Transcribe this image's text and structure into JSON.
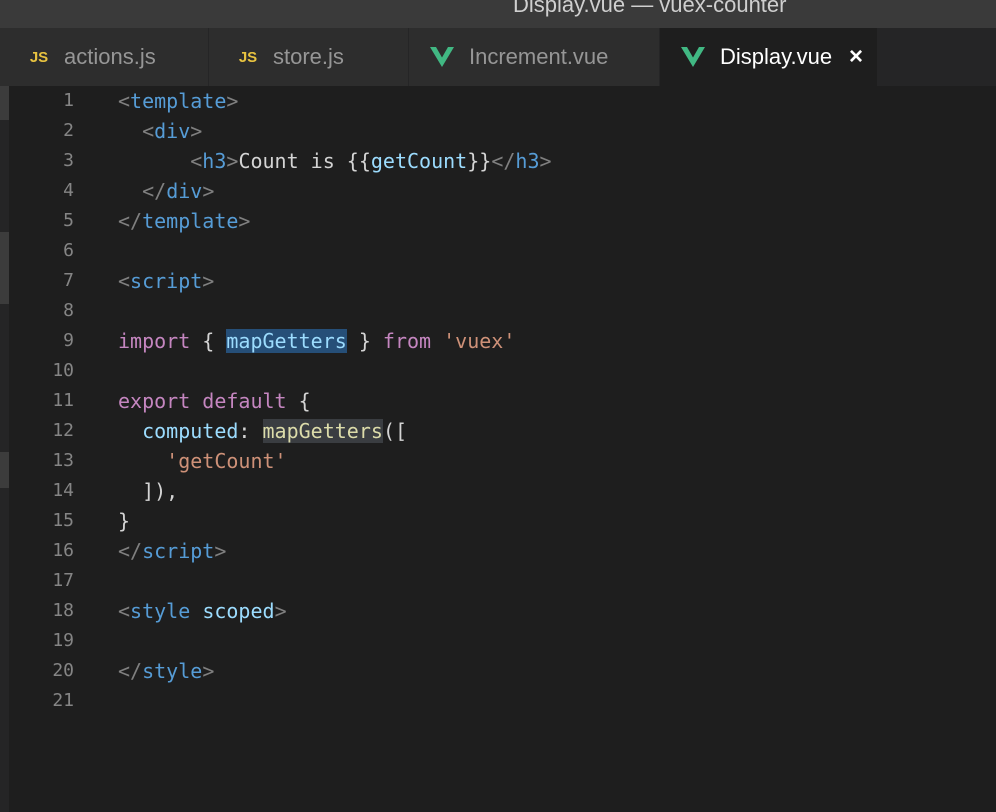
{
  "window": {
    "title": "Display.vue — vuex-counter"
  },
  "tabs": [
    {
      "label": "actions.js",
      "icon": "js-icon",
      "icon_text": "JS",
      "active": false
    },
    {
      "label": "store.js",
      "icon": "js-icon",
      "icon_text": "JS",
      "active": false
    },
    {
      "label": "Increment.vue",
      "icon": "vue-icon",
      "active": false
    },
    {
      "label": "Display.vue",
      "icon": "vue-icon",
      "active": true,
      "close_symbol": "×"
    }
  ],
  "colors": {
    "background": "#1e1e1e",
    "tab_inactive": "#2d2d2d",
    "js_icon": "#e8c340",
    "vue_icon": "#41b883"
  },
  "editor": {
    "line_numbers": [
      "1",
      "2",
      "3",
      "4",
      "5",
      "6",
      "7",
      "8",
      "9",
      "10",
      "11",
      "12",
      "13",
      "14",
      "15",
      "16",
      "17",
      "18",
      "19",
      "20",
      "21"
    ],
    "lines": [
      [
        {
          "t": "<",
          "c": "tag-bracket"
        },
        {
          "t": "template",
          "c": "tag"
        },
        {
          "t": ">",
          "c": "tag-bracket"
        }
      ],
      [
        {
          "t": "  ",
          "c": "plain"
        },
        {
          "t": "<",
          "c": "tag-bracket"
        },
        {
          "t": "div",
          "c": "tag"
        },
        {
          "t": ">",
          "c": "tag-bracket"
        }
      ],
      [
        {
          "t": "      ",
          "c": "plain"
        },
        {
          "t": "<",
          "c": "tag-bracket"
        },
        {
          "t": "h3",
          "c": "tag"
        },
        {
          "t": ">",
          "c": "tag-bracket"
        },
        {
          "t": "Count is {{",
          "c": "plain"
        },
        {
          "t": "getCount",
          "c": "prop"
        },
        {
          "t": "}}",
          "c": "plain"
        },
        {
          "t": "</",
          "c": "tag-bracket"
        },
        {
          "t": "h3",
          "c": "tag"
        },
        {
          "t": ">",
          "c": "tag-bracket"
        }
      ],
      [
        {
          "t": "  ",
          "c": "plain"
        },
        {
          "t": "</",
          "c": "tag-bracket"
        },
        {
          "t": "div",
          "c": "tag"
        },
        {
          "t": ">",
          "c": "tag-bracket"
        }
      ],
      [
        {
          "t": "</",
          "c": "tag-bracket"
        },
        {
          "t": "template",
          "c": "tag"
        },
        {
          "t": ">",
          "c": "tag-bracket"
        }
      ],
      [],
      [
        {
          "t": "<",
          "c": "tag-bracket"
        },
        {
          "t": "script",
          "c": "tag"
        },
        {
          "t": ">",
          "c": "tag-bracket"
        }
      ],
      [],
      [
        {
          "t": "import",
          "c": "keyword"
        },
        {
          "t": " { ",
          "c": "plain"
        },
        {
          "t": "mapGetters",
          "c": "prop hl-select"
        },
        {
          "t": " } ",
          "c": "plain"
        },
        {
          "t": "from",
          "c": "keyword"
        },
        {
          "t": " ",
          "c": "plain"
        },
        {
          "t": "'vuex'",
          "c": "string"
        }
      ],
      [],
      [
        {
          "t": "export",
          "c": "keyword"
        },
        {
          "t": " ",
          "c": "plain"
        },
        {
          "t": "default",
          "c": "keyword"
        },
        {
          "t": " {",
          "c": "plain"
        }
      ],
      [
        {
          "t": "  ",
          "c": "plain"
        },
        {
          "t": "computed",
          "c": "prop"
        },
        {
          "t": ": ",
          "c": "plain"
        },
        {
          "t": "mapGetters",
          "c": "func hl-word"
        },
        {
          "t": "([",
          "c": "plain"
        }
      ],
      [
        {
          "t": "    ",
          "c": "plain"
        },
        {
          "t": "'getCount'",
          "c": "string"
        }
      ],
      [
        {
          "t": "  ]),",
          "c": "plain"
        }
      ],
      [
        {
          "t": "}",
          "c": "plain"
        }
      ],
      [
        {
          "t": "</",
          "c": "tag-bracket"
        },
        {
          "t": "script",
          "c": "tag"
        },
        {
          "t": ">",
          "c": "tag-bracket"
        }
      ],
      [],
      [
        {
          "t": "<",
          "c": "tag-bracket"
        },
        {
          "t": "style",
          "c": "tag"
        },
        {
          "t": " ",
          "c": "plain"
        },
        {
          "t": "scoped",
          "c": "attr"
        },
        {
          "t": ">",
          "c": "tag-bracket"
        }
      ],
      [],
      [
        {
          "t": "</",
          "c": "tag-bracket"
        },
        {
          "t": "style",
          "c": "tag"
        },
        {
          "t": ">",
          "c": "tag-bracket"
        }
      ],
      []
    ]
  }
}
